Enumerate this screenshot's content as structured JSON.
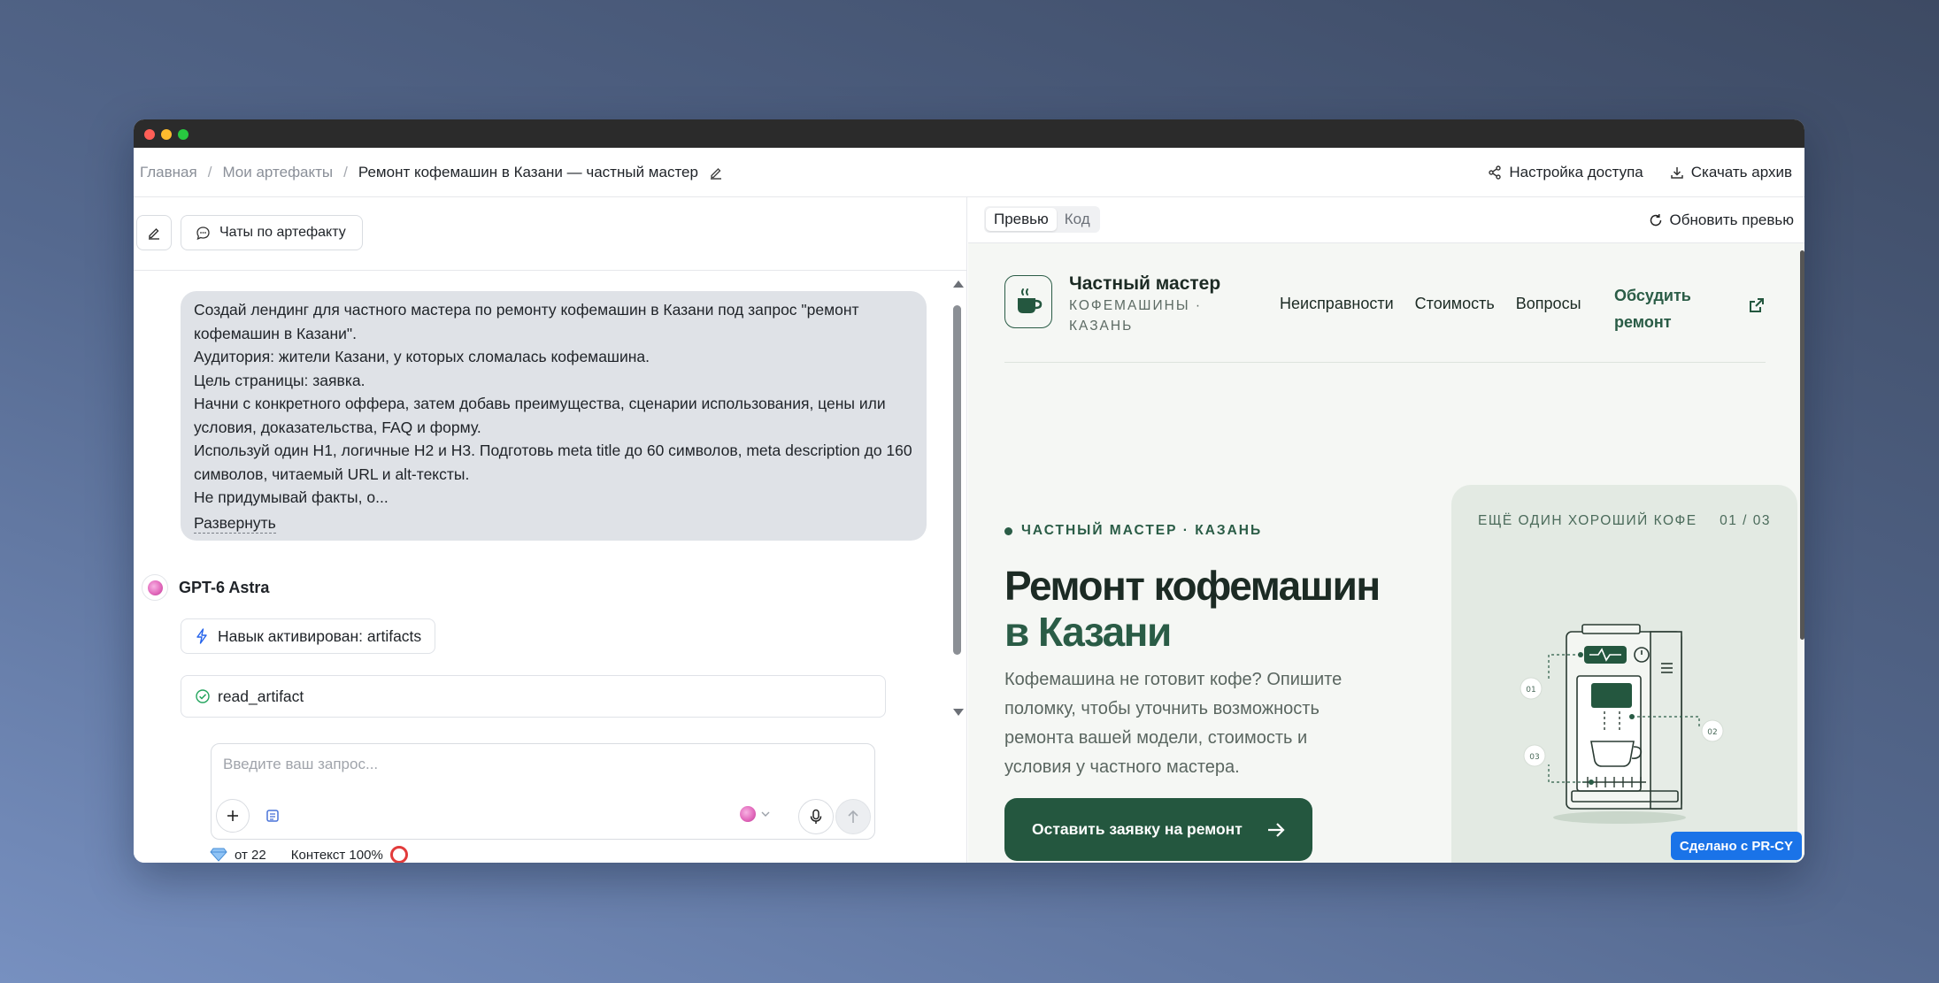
{
  "breadcrumb": {
    "home": "Главная",
    "artifacts": "Мои артефакты",
    "current": "Ремонт кофемашин в Казани — частный мастер"
  },
  "top_actions": {
    "access": "Настройка доступа",
    "download": "Скачать архив"
  },
  "left_toolbar": {
    "chats_button": "Чаты по артефакту"
  },
  "user_message": {
    "lines": [
      "Создай лендинг для частного мастера по ремонту кофемашин в Казани под запрос \"ремонт кофемашин в Казани\".",
      "Аудитория: жители Казани, у которых сломалась кофемашина.",
      "Цель страницы: заявка.",
      "Начни с конкретного оффера, затем добавь преимущества, сценарии использования, цены или условия, доказательства, FAQ и форму.",
      "Используй один H1, логичные H2 и H3. Подготовь meta title до 60 символов, meta description до 160 символов, читаемый URL и alt-тексты.",
      "Не придумывай факты, о..."
    ],
    "expand": "Развернуть"
  },
  "assistant": {
    "name": "GPT-6 Astra",
    "skill": "Навык активирован: artifacts",
    "tool": "read_artifact"
  },
  "composer": {
    "placeholder": "Введите ваш запрос..."
  },
  "footer": {
    "cost": "от 22",
    "context": "Контекст 100%"
  },
  "preview_toolbar": {
    "tab_preview": "Превью",
    "tab_code": "Код",
    "refresh": "Обновить превью"
  },
  "site": {
    "brand_name": "Частный мастер",
    "brand_sub": "КОФЕМАШИНЫ · КАЗАНЬ",
    "nav": [
      "Неисправности",
      "Стоимость",
      "Вопросы"
    ],
    "cta_link": "Обсудить ремонт",
    "eyebrow": "ЧАСТНЫЙ МАСТЕР · КАЗАНЬ",
    "hero_title_main": "Ремонт кофемашин",
    "hero_title_accent": "в Казани",
    "hero_text": "Кофемашина не готовит кофе? Опишите поломку, чтобы уточнить возможность ремонта вашей модели, стоимость и условия у частного мастера.",
    "hero_button": "Оставить заявку на ремонт",
    "visual_label": "ЕЩЁ ОДИН ХОРОШИЙ КОФЕ",
    "visual_count": "01 / 03",
    "callouts": [
      "01",
      "02",
      "03"
    ]
  },
  "badge": "Сделано с PR-CY",
  "colors": {
    "brand_green": "#2a5c46",
    "button_green": "#24573f",
    "badge_blue": "#1a73e8"
  }
}
